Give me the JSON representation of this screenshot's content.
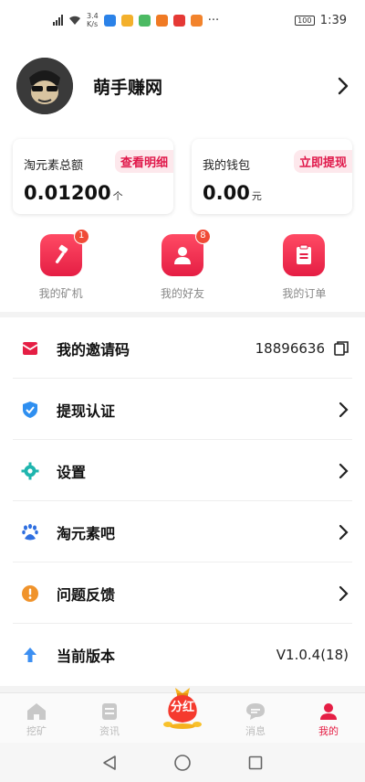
{
  "status_bar": {
    "network": "4G",
    "speed_value": "3.4",
    "speed_unit": "K/s",
    "more": "···",
    "battery": "100",
    "time": "1:39"
  },
  "profile": {
    "name": "萌手赚网"
  },
  "cards": [
    {
      "label": "淘元素总额",
      "tag": "查看明细",
      "value": "0.01200",
      "unit": "个"
    },
    {
      "label": "我的钱包",
      "tag": "立即提现",
      "value": "0.00",
      "unit": "元"
    }
  ],
  "quick_actions": [
    {
      "label": "我的矿机",
      "icon": "hammer-icon",
      "badge": "1"
    },
    {
      "label": "我的好友",
      "icon": "user-icon",
      "badge": "8"
    },
    {
      "label": "我的订单",
      "icon": "clipboard-icon",
      "badge": ""
    }
  ],
  "menu": [
    {
      "label": "我的邀请码",
      "icon": "envelope-icon",
      "value": "18896636",
      "action": "copy-icon",
      "color": "#e51e44"
    },
    {
      "label": "提现认证",
      "icon": "shield-check-icon",
      "value": "",
      "action": "chevron-right-icon",
      "color": "#2f8ff0"
    },
    {
      "label": "设置",
      "icon": "gear-icon",
      "value": "",
      "action": "chevron-right-icon",
      "color": "#1fb5ae"
    },
    {
      "label": "淘元素吧",
      "icon": "paw-icon",
      "value": "",
      "action": "chevron-right-icon",
      "color": "#2f6fe0"
    },
    {
      "label": "问题反馈",
      "icon": "alert-circle-icon",
      "value": "",
      "action": "chevron-right-icon",
      "color": "#f0932b"
    },
    {
      "label": "当前版本",
      "icon": "arrow-up-icon",
      "value": "V1.0.4(18)",
      "action": "",
      "color": "#3c8ff2"
    }
  ],
  "tabbar": [
    {
      "label": "挖矿",
      "icon": "home-icon",
      "active": false
    },
    {
      "label": "资讯",
      "icon": "news-icon",
      "active": false
    },
    {
      "label": "分红",
      "icon": "money-bag-icon",
      "active": false
    },
    {
      "label": "消息",
      "icon": "chat-icon",
      "active": false
    },
    {
      "label": "我的",
      "icon": "profile-icon",
      "active": true
    }
  ],
  "colors": {
    "accent": "#e51e44",
    "tag_bg": "#fde8ec",
    "badge": "#f04b37"
  }
}
